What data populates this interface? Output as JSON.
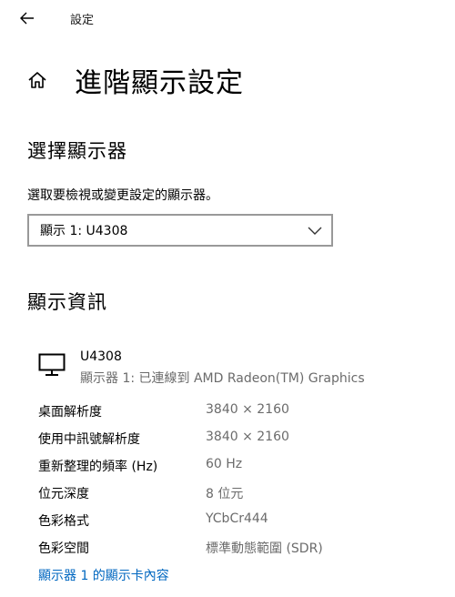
{
  "titlebar": {
    "app_title": "設定",
    "back_icon": "arrow-left-icon"
  },
  "header": {
    "home_icon": "home-icon",
    "page_title": "進階顯示設定"
  },
  "select_display": {
    "section_title": "選擇顯示器",
    "description": "選取要檢視或變更設定的顯示器。",
    "dropdown_value": "顯示 1: U4308",
    "chevron_icon": "chevron-down-icon"
  },
  "display_info": {
    "section_title": "顯示資訊",
    "monitor_icon": "monitor-icon",
    "monitor_name": "U4308",
    "monitor_connection": "顯示器 1: 已連線到 AMD Radeon(TM) Graphics",
    "rows": [
      {
        "label": "桌面解析度",
        "value": "3840 × 2160"
      },
      {
        "label": "使用中訊號解析度",
        "value": "3840 × 2160"
      },
      {
        "label": "重新整理的頻率 (Hz)",
        "value": "60 Hz"
      },
      {
        "label": "位元深度",
        "value": "8 位元"
      },
      {
        "label": "色彩格式",
        "value": "YCbCr444"
      },
      {
        "label": "色彩空間",
        "value": "標準動態範圍 (SDR)"
      }
    ],
    "adapter_link": "顯示器 1 的顯示卡內容"
  },
  "colors": {
    "link": "#0067c0",
    "secondary_text": "#6b6b6b",
    "dropdown_border": "#999999"
  }
}
